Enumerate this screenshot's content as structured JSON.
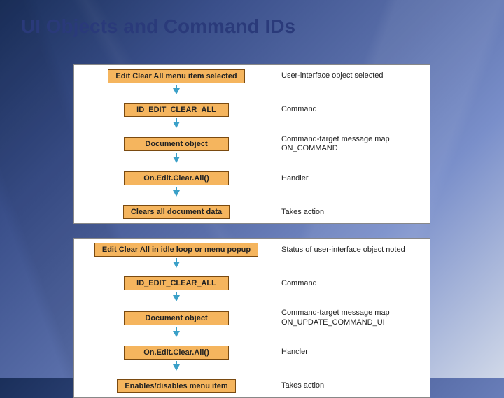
{
  "title": "UI Objects and Command IDs",
  "flows": [
    {
      "steps": [
        {
          "box": "Edit Clear All menu item selected",
          "desc": "User-interface object selected"
        },
        {
          "box": "ID_EDIT_CLEAR_ALL",
          "desc": "Command"
        },
        {
          "box": "Document object",
          "desc": "Command-target message map ON_COMMAND"
        },
        {
          "box": "On.Edit.Clear.All()",
          "desc": "Handler"
        },
        {
          "box": "Clears all document data",
          "desc": "Takes action"
        }
      ]
    },
    {
      "steps": [
        {
          "box": "Edit Clear All in idle loop or menu popup",
          "desc": "Status of user-interface object noted"
        },
        {
          "box": "ID_EDIT_CLEAR_ALL",
          "desc": "Command"
        },
        {
          "box": "Document object",
          "desc": "Command-target message map ON_UPDATE_COMMAND_UI"
        },
        {
          "box": "On.Edit.Clear.All()",
          "desc": "Hancler"
        },
        {
          "box": "Enables/disables menu item",
          "desc": "Takes action"
        }
      ]
    }
  ]
}
